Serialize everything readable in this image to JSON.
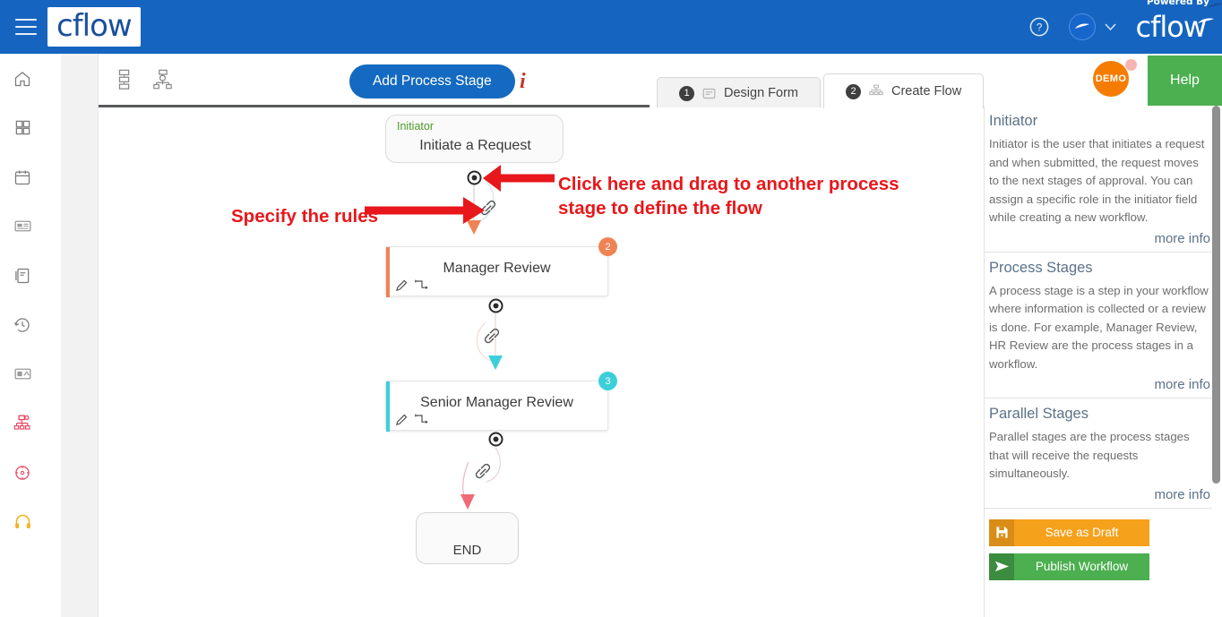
{
  "topbar": {
    "menu_icon": "hamburger-icon",
    "logo_text": "cflow",
    "help_icon": "question-circle-icon",
    "avatar_icon": "user-avatar-icon",
    "chevron_icon": "chevron-down-icon",
    "powered_by_label": "Powered By",
    "powered_logo_text": "cflow",
    "bg_color": "#1565c0"
  },
  "sidebar": {
    "items": [
      {
        "name": "home-icon",
        "label": "Home",
        "color": "#7a7a7a"
      },
      {
        "name": "dashboard-grid-icon",
        "label": "Dashboard",
        "color": "#7a7a7a"
      },
      {
        "name": "calendar-icon",
        "label": "Calendar",
        "color": "#7a7a7a"
      },
      {
        "name": "card-icon",
        "label": "Cards",
        "color": "#9a9a9a"
      },
      {
        "name": "document-icon",
        "label": "Documents",
        "color": "#7a7a7a"
      },
      {
        "name": "history-clock-icon",
        "label": "History",
        "color": "#7a7a7a"
      },
      {
        "name": "image-card-icon",
        "label": "Reports",
        "color": "#9a9a9a"
      },
      {
        "name": "workflow-tree-icon",
        "label": "Workflows",
        "color": "#e8455f"
      },
      {
        "name": "target-clock-icon",
        "label": "Rules",
        "color": "#e8455f"
      },
      {
        "name": "headset-icon",
        "label": "Support",
        "color": "#f0b323"
      }
    ]
  },
  "toolbar": {
    "view_list_icon": "stacked-list-view-icon",
    "view_tree_icon": "hierarchy-view-icon",
    "add_stage_label": "Add Process Stage",
    "info_icon": "info-italic-icon",
    "tabs": [
      {
        "num": "1",
        "label": "Design Form",
        "icon": "form-icon",
        "active": false
      },
      {
        "num": "2",
        "label": "Create Flow",
        "icon": "flow-icon",
        "active": true
      }
    ],
    "demo_badge_label": "DEMO",
    "help_label": "Help",
    "accent_color": "#1469c0",
    "help_color": "#4caf50"
  },
  "canvas": {
    "initiator": {
      "label": "Initiator",
      "title": "Initiate a Request",
      "label_color": "#4c9a2a"
    },
    "stages": [
      {
        "title": "Manager Review",
        "badge": "2",
        "accent_color": "#ef8354",
        "edit_icon": "pencil-edit-icon",
        "branch_icon": "branch-flow-icon"
      },
      {
        "title": "Senior Manager Review",
        "badge": "3",
        "accent_color": "#3ccfd9",
        "edit_icon": "pencil-edit-icon",
        "branch_icon": "branch-flow-icon"
      }
    ],
    "end_node": {
      "label": "END"
    },
    "connector_icons": {
      "handle": "connector-handle-icon",
      "rule_link": "rule-link-chain-icon"
    },
    "annotations": [
      {
        "name": "specify-rules-annotation",
        "text": "Specify the rules",
        "color": "#e8171b"
      },
      {
        "name": "click-drag-annotation",
        "text": "Click here and drag to another process\nstage to define the flow",
        "color": "#e8171b"
      }
    ]
  },
  "side_panel": {
    "sections": [
      {
        "title": "Initiator",
        "body": "Initiator is the user that initiates a request and when submitted, the request moves to the next stages of approval. You can assign a specific role in the initiator field while creating a new workflow.",
        "more": "more info"
      },
      {
        "title": "Process Stages",
        "body": "A process stage is a step in your workflow where information is collected or a review is done. For example, Manager Review, HR Review are the process stages in a workflow.",
        "more": "more info"
      },
      {
        "title": "Parallel Stages",
        "body": "Parallel stages are the process stages that will receive the requests simultaneously.",
        "more": "more info"
      }
    ],
    "actions": {
      "save_draft_label": "Save as Draft",
      "save_draft_icon": "floppy-save-icon",
      "save_draft_color": "#f5a11b",
      "publish_label": "Publish Workflow",
      "publish_icon": "send-arrow-icon",
      "publish_color": "#4caf50"
    }
  }
}
